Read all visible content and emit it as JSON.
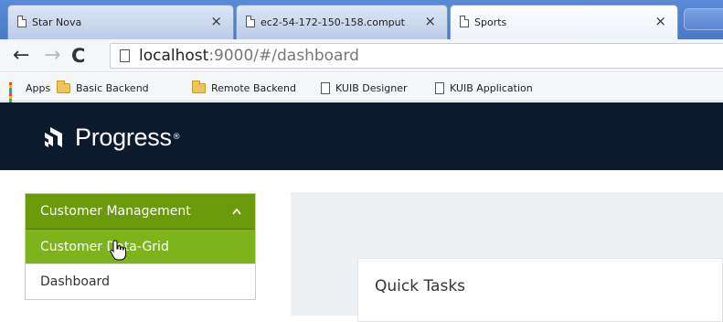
{
  "browser": {
    "tabs": [
      {
        "title": "Star Nova",
        "close": "×"
      },
      {
        "title": "ec2-54-172-150-158.comput",
        "close": "×"
      },
      {
        "title": "Sports",
        "close": "×"
      }
    ],
    "nav": {
      "back": "←",
      "forward": "→",
      "reload": "C"
    },
    "url": {
      "host": "localhost",
      "rest": ":9000/#/dashboard"
    },
    "bookmarks": [
      {
        "label": "Apps",
        "icon": "apps-icon"
      },
      {
        "label": "Basic Backend",
        "icon": "folder-icon"
      },
      {
        "label": "Remote Backend",
        "icon": "folder-icon"
      },
      {
        "label": "KUIB Designer",
        "icon": "page-icon"
      },
      {
        "label": "KUIB Application",
        "icon": "page-icon"
      }
    ]
  },
  "app": {
    "logo_text": "Progress",
    "logo_mark": "®",
    "colors": {
      "header": "#0c1a2e",
      "panel": "#6b9a0a",
      "active": "#7db31b"
    }
  },
  "sidebar": {
    "group_label": "Customer Management",
    "group_chevron": "^",
    "items": [
      {
        "label": "Customer Data-Grid",
        "active": true
      },
      {
        "label": "Dashboard",
        "active": false
      }
    ]
  },
  "main": {
    "card_title": "Quick Tasks"
  }
}
